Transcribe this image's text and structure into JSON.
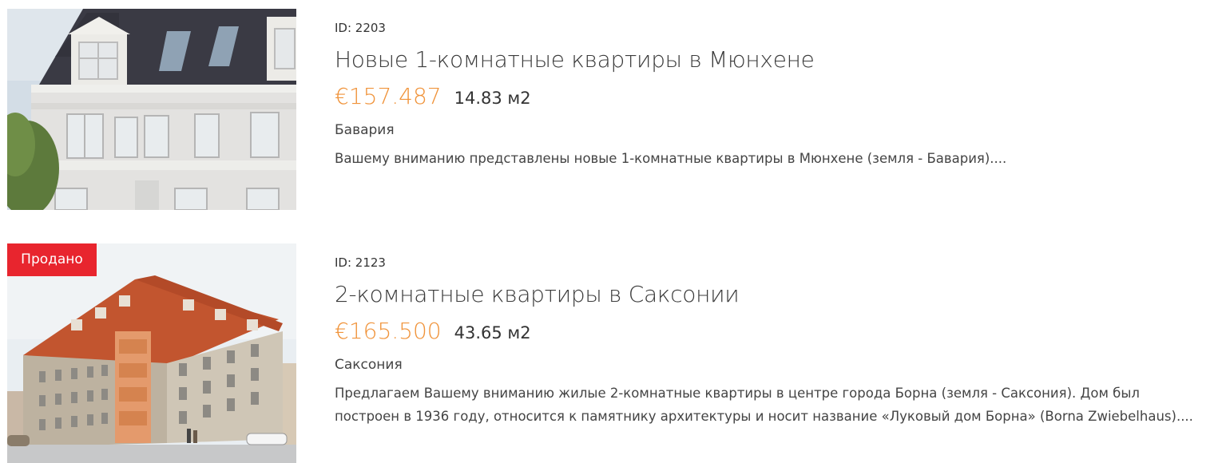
{
  "listings": [
    {
      "id_label": "ID: 2203",
      "title": "Новые 1-комнатные квартиры в Мюнхене",
      "price": "€157.487",
      "area": "14.83 м2",
      "region": "Бавария",
      "description": [
        "Вашему вниманию представлены новые 1-комнатные квартиры в Мюнхене (земля - Бавария)...."
      ],
      "badge": ""
    },
    {
      "id_label": "ID: 2123",
      "title": "2-комнатные квартиры в Саксонии",
      "price": "€165.500",
      "area": "43.65 м2",
      "region": "Саксония",
      "description": [
        "Предлагаем Вашему вниманию жилые 2-комнатные квартиры в центре города Борна (земля - Саксония). Дом был",
        "построен в 1936 году, относится к памятнику архитектуры и носит название «Луковый дом Борна» (Borna Zwiebelhaus)...."
      ],
      "badge": "Продано"
    }
  ],
  "colors": {
    "price": "#f0933a",
    "badge": "#e8252e"
  }
}
